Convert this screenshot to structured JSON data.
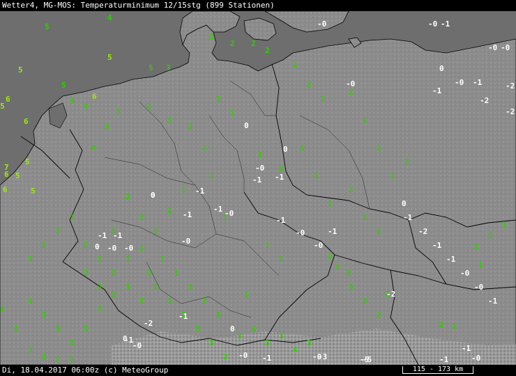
{
  "header": {
    "title": "Wetter4, MG-MOS: Temperaturminimum 12/15stg (899 Stationen)"
  },
  "footer": {
    "timestamp": "Di, 18.04.2017 06:00z (c) MeteoGroup",
    "scale": "115 - 173 km"
  },
  "colors": {
    "sea": "#6e6e6e",
    "land": "#8c8c8c",
    "positive": "#33cc00",
    "zero_negative": "#ffffff",
    "sea_label": "#99ee00",
    "border": "#000000"
  },
  "stations": [
    {
      "v": "4",
      "c": "p"
    },
    {
      "v": "5",
      "c": "p"
    },
    {
      "v": "5",
      "c": "s"
    },
    {
      "v": "5",
      "c": "s"
    },
    {
      "v": "5",
      "c": "p"
    },
    {
      "v": "3",
      "c": "p"
    },
    {
      "v": "5",
      "c": "s"
    },
    {
      "v": "4",
      "c": "p"
    },
    {
      "v": "6",
      "c": "s"
    },
    {
      "v": "6",
      "c": "s"
    },
    {
      "v": "5",
      "c": "s"
    },
    {
      "v": "5",
      "c": "p"
    },
    {
      "v": "4",
      "c": "p"
    },
    {
      "v": "3",
      "c": "p"
    },
    {
      "v": "3",
      "c": "p"
    },
    {
      "v": "2",
      "c": "p"
    },
    {
      "v": "3",
      "c": "p"
    },
    {
      "v": "4",
      "c": "p"
    },
    {
      "v": "6",
      "c": "s"
    },
    {
      "v": "5",
      "c": "s"
    },
    {
      "v": "7",
      "c": "s"
    },
    {
      "v": "6",
      "c": "s"
    },
    {
      "v": "5",
      "c": "s"
    },
    {
      "v": "6",
      "c": "s"
    },
    {
      "v": "2",
      "c": "p"
    },
    {
      "v": "2",
      "c": "p"
    },
    {
      "v": "2",
      "c": "p"
    },
    {
      "v": "2",
      "c": "p"
    },
    {
      "v": "1",
      "c": "p"
    },
    {
      "v": "2",
      "c": "p"
    },
    {
      "v": "1",
      "c": "p"
    },
    {
      "v": "2",
      "c": "p"
    },
    {
      "v": "1",
      "c": "p"
    },
    {
      "v": "1",
      "c": "p"
    },
    {
      "v": "1",
      "c": "p"
    },
    {
      "v": "2",
      "c": "p"
    },
    {
      "v": "0",
      "c": "z"
    },
    {
      "v": "-0",
      "c": "z"
    },
    {
      "v": "-1",
      "c": "z"
    },
    {
      "v": "-0",
      "c": "z"
    },
    {
      "v": "-0",
      "c": "z"
    },
    {
      "v": "-0",
      "c": "z"
    },
    {
      "v": "0",
      "c": "z"
    },
    {
      "v": "-1",
      "c": "z"
    },
    {
      "v": "-1",
      "c": "z"
    },
    {
      "v": "-2",
      "c": "z"
    },
    {
      "v": "-2",
      "c": "z"
    },
    {
      "v": "-2",
      "c": "z"
    },
    {
      "v": "-0",
      "c": "z"
    },
    {
      "v": "-0",
      "c": "z"
    },
    {
      "v": "1",
      "c": "p"
    },
    {
      "v": "1",
      "c": "p"
    },
    {
      "v": "2",
      "c": "p"
    },
    {
      "v": "2",
      "c": "p"
    },
    {
      "v": "1",
      "c": "p"
    },
    {
      "v": "2",
      "c": "p"
    },
    {
      "v": "1",
      "c": "p"
    },
    {
      "v": "1",
      "c": "p"
    },
    {
      "v": "0",
      "c": "z"
    },
    {
      "v": "1",
      "c": "p"
    },
    {
      "v": "2",
      "c": "p"
    },
    {
      "v": "1",
      "c": "p"
    },
    {
      "v": "1",
      "c": "p"
    },
    {
      "v": "-0",
      "c": "z"
    },
    {
      "v": "-1",
      "c": "z"
    },
    {
      "v": "-1",
      "c": "z"
    },
    {
      "v": "1",
      "c": "p"
    },
    {
      "v": "1",
      "c": "p"
    },
    {
      "v": "1",
      "c": "p"
    },
    {
      "v": "0",
      "c": "z"
    },
    {
      "v": "-1",
      "c": "z"
    },
    {
      "v": "1",
      "c": "p"
    },
    {
      "v": "2",
      "c": "p"
    },
    {
      "v": "2",
      "c": "p"
    },
    {
      "v": "1",
      "c": "p"
    },
    {
      "v": "-1",
      "c": "z"
    },
    {
      "v": "-0",
      "c": "z"
    },
    {
      "v": "-1",
      "c": "z"
    },
    {
      "v": "3",
      "c": "p"
    },
    {
      "v": "3",
      "c": "p"
    },
    {
      "v": "2",
      "c": "p"
    },
    {
      "v": "3",
      "c": "p"
    },
    {
      "v": "2",
      "c": "p"
    },
    {
      "v": "2",
      "c": "p"
    },
    {
      "v": "2",
      "c": "p"
    },
    {
      "v": "3",
      "c": "p"
    },
    {
      "v": "3",
      "c": "p"
    },
    {
      "v": "4",
      "c": "p"
    },
    {
      "v": "3",
      "c": "p"
    },
    {
      "v": "3",
      "c": "p"
    },
    {
      "v": "3",
      "c": "p"
    },
    {
      "v": "2",
      "c": "p"
    },
    {
      "v": "2",
      "c": "p"
    },
    {
      "v": "1",
      "c": "p"
    },
    {
      "v": "-1",
      "c": "z"
    },
    {
      "v": "-1",
      "c": "z"
    },
    {
      "v": "0",
      "c": "z"
    },
    {
      "v": "-0",
      "c": "z"
    },
    {
      "v": "0",
      "c": "z"
    },
    {
      "v": "-0",
      "c": "z"
    },
    {
      "v": "1",
      "c": "p"
    },
    {
      "v": "-0",
      "c": "z"
    },
    {
      "v": "-1",
      "c": "z"
    },
    {
      "v": "-0",
      "c": "z"
    },
    {
      "v": "1",
      "c": "p"
    },
    {
      "v": "1",
      "c": "p"
    },
    {
      "v": "-0",
      "c": "z"
    },
    {
      "v": "-1",
      "c": "z"
    },
    {
      "v": "3",
      "c": "p"
    },
    {
      "v": "3",
      "c": "p"
    },
    {
      "v": "2",
      "c": "p"
    },
    {
      "v": "2",
      "c": "p"
    },
    {
      "v": "3",
      "c": "p"
    },
    {
      "v": "3",
      "c": "p"
    },
    {
      "v": "2",
      "c": "p"
    },
    {
      "v": "2",
      "c": "p"
    },
    {
      "v": "1",
      "c": "p"
    },
    {
      "v": "1",
      "c": "p"
    },
    {
      "v": "0",
      "c": "z"
    },
    {
      "v": "-1",
      "c": "z"
    },
    {
      "v": "-2",
      "c": "z"
    },
    {
      "v": "-1",
      "c": "z"
    },
    {
      "v": "-1",
      "c": "z"
    },
    {
      "v": "-0",
      "c": "z"
    },
    {
      "v": "-0",
      "c": "z"
    },
    {
      "v": "-1",
      "c": "z"
    },
    {
      "v": "1",
      "c": "p"
    },
    {
      "v": "1",
      "c": "p"
    },
    {
      "v": "2",
      "c": "p"
    },
    {
      "v": "3",
      "c": "p"
    },
    {
      "v": "3",
      "c": "p"
    },
    {
      "v": "2",
      "c": "p"
    },
    {
      "v": "3",
      "c": "p"
    },
    {
      "v": "4",
      "c": "p"
    },
    {
      "v": "3",
      "c": "p"
    },
    {
      "v": "3",
      "c": "p"
    },
    {
      "v": "4",
      "c": "p"
    },
    {
      "v": "3",
      "c": "p"
    },
    {
      "v": "3",
      "c": "p"
    },
    {
      "v": "2",
      "c": "p"
    },
    {
      "v": "1",
      "c": "p"
    },
    {
      "v": "-1",
      "c": "z"
    },
    {
      "v": "-2",
      "c": "z"
    },
    {
      "v": "-1",
      "c": "z"
    },
    {
      "v": "-0",
      "c": "z"
    },
    {
      "v": "-3",
      "c": "z"
    },
    {
      "v": "-5",
      "c": "z"
    },
    {
      "v": "-1",
      "c": "z"
    },
    {
      "v": "-0",
      "c": "z"
    },
    {
      "v": "-1",
      "c": "z"
    },
    {
      "v": "0",
      "c": "z"
    },
    {
      "v": "-0",
      "c": "z"
    },
    {
      "v": "-2",
      "c": "z"
    },
    {
      "v": "-0",
      "c": "z"
    },
    {
      "v": "-1",
      "c": "z"
    },
    {
      "v": "-5",
      "c": "z"
    },
    {
      "v": "4",
      "c": "p"
    },
    {
      "v": "4",
      "c": "p"
    },
    {
      "v": "3",
      "c": "p"
    },
    {
      "v": "3",
      "c": "p"
    },
    {
      "v": "2",
      "c": "p"
    },
    {
      "v": "2",
      "c": "p"
    },
    {
      "v": "3",
      "c": "p"
    },
    {
      "v": "2",
      "c": "p"
    },
    {
      "v": "2",
      "c": "p"
    },
    {
      "v": "1",
      "c": "p"
    },
    {
      "v": "3",
      "c": "p"
    },
    {
      "v": "1",
      "c": "p"
    },
    {
      "v": "1",
      "c": "p"
    },
    {
      "v": "1",
      "c": "p"
    },
    {
      "v": "3",
      "c": "p"
    },
    {
      "v": "1",
      "c": "p"
    },
    {
      "v": "0",
      "c": "z"
    },
    {
      "v": "1",
      "c": "p"
    }
  ]
}
